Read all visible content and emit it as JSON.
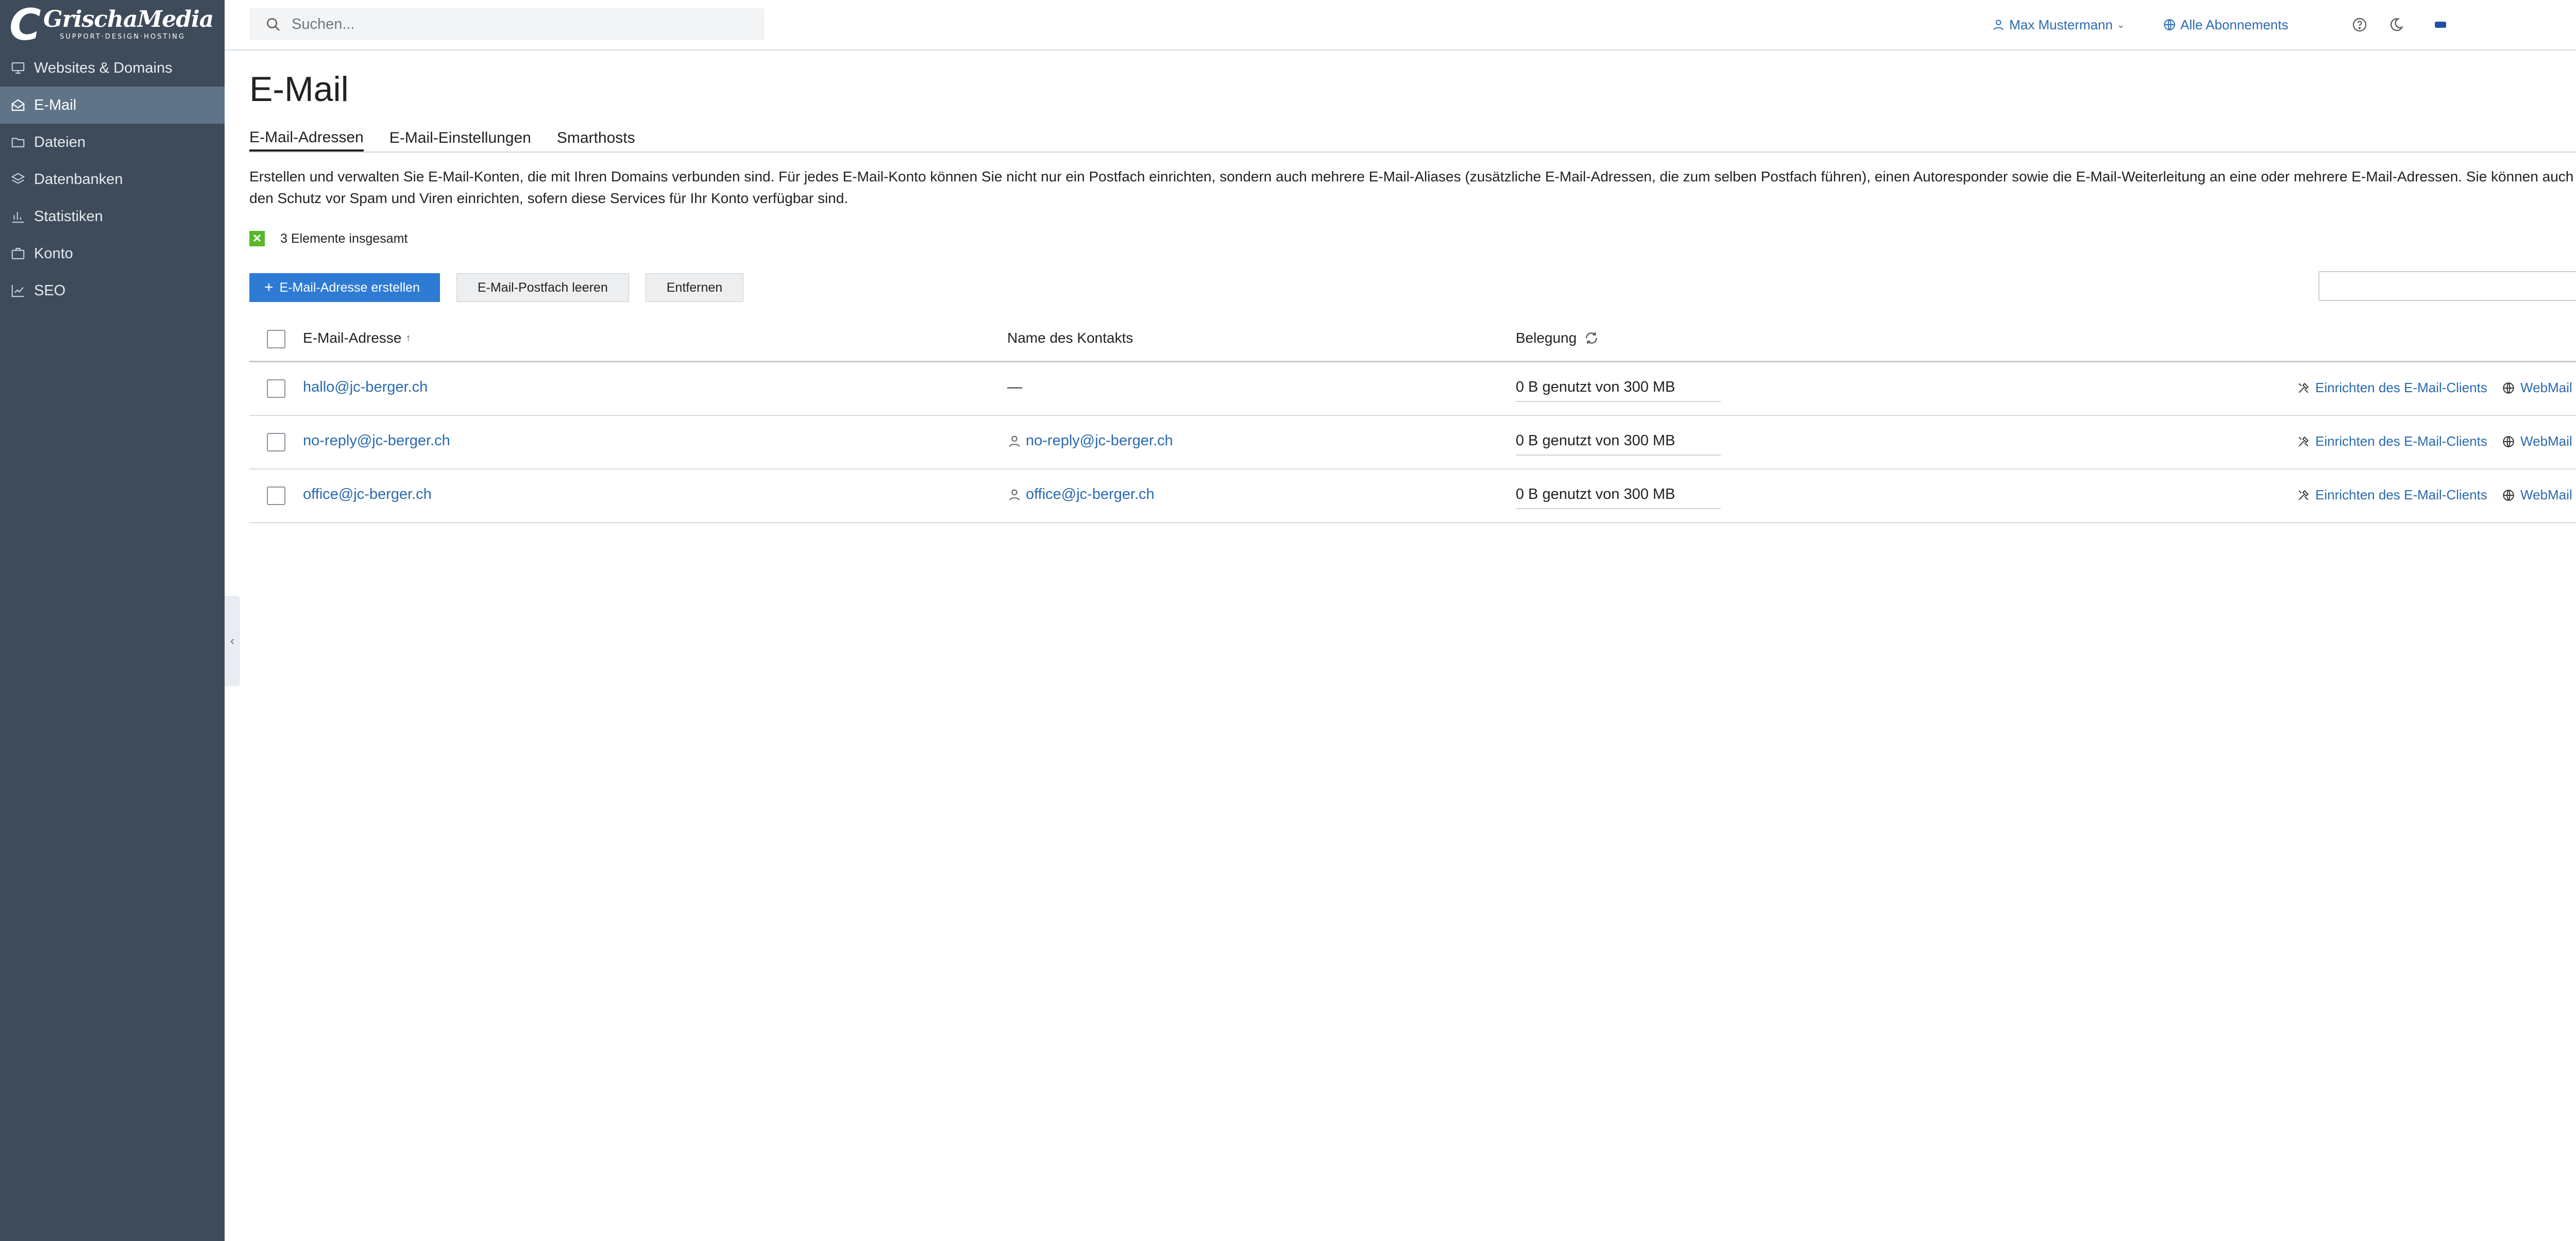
{
  "brand": {
    "name": "GrischaMedia",
    "tagline": "SUPPORT·DESIGN·HOSTING"
  },
  "sidebar": {
    "items": [
      {
        "label": "Websites & Domains",
        "icon": "monitor-icon"
      },
      {
        "label": "E-Mail",
        "icon": "envelope-icon",
        "active": true
      },
      {
        "label": "Dateien",
        "icon": "folder-icon"
      },
      {
        "label": "Datenbanken",
        "icon": "layers-icon"
      },
      {
        "label": "Statistiken",
        "icon": "bar-chart-icon"
      },
      {
        "label": "Konto",
        "icon": "briefcase-icon"
      },
      {
        "label": "SEO",
        "icon": "trend-icon"
      }
    ],
    "collapse_glyph": "‹"
  },
  "header": {
    "search_placeholder": "Suchen...",
    "user_name": "Max Mustermann",
    "subscriptions": "Alle Abonnements"
  },
  "main": {
    "title": "E-Mail",
    "tabs": [
      {
        "label": "E-Mail-Adressen",
        "active": true
      },
      {
        "label": "E-Mail-Einstellungen"
      },
      {
        "label": "Smarthosts"
      }
    ],
    "description": "Erstellen und verwalten Sie E-Mail-Konten, die mit Ihren Domains verbunden sind. Für jedes E-Mail-Konto können Sie nicht nur ein Postfach einrichten, sondern auch mehrere E-Mail-Aliases (zusätzliche E-Mail-Adressen, die zum selben Postfach führen), einen Autoresponder sowie die E-Mail-Weiterleitung an eine oder mehrere E-Mail-Adressen. Sie können auch den Schutz vor Spam und Viren einrichten, sofern diese Services für Ihr Konto verfügbar sind.",
    "count_text": "3 Elemente insgesamt",
    "buttons": {
      "create": "E-Mail-Adresse erstellen",
      "empty": "E-Mail-Postfach leeren",
      "remove": "Entfernen"
    },
    "table": {
      "columns": {
        "address": "E-Mail-Adresse",
        "sort_indicator": "↑",
        "contact": "Name des Kontakts",
        "usage": "Belegung"
      },
      "rows": [
        {
          "address": "hallo@jc-berger.ch",
          "contact": "—",
          "usage": "0 B genutzt von 300 MB",
          "setup": "Einrichten des E-Mail-Clients",
          "webmail": "WebMail"
        },
        {
          "address": "no-reply@jc-berger.ch",
          "contact": "no-reply@jc-berger.ch",
          "usage": "0 B genutzt von 300 MB",
          "setup": "Einrichten des E-Mail-Clients",
          "webmail": "WebMail"
        },
        {
          "address": "office@jc-berger.ch",
          "contact": "office@jc-berger.ch",
          "usage": "0 B genutzt von 300 MB",
          "setup": "Einrichten des E-Mail-Clients",
          "webmail": "WebMail"
        }
      ]
    }
  },
  "colors": {
    "sidebar_bg": "#3e4b5a",
    "sidebar_active": "#5f7487",
    "link": "#2a6ab0",
    "primary_button": "#2e7bd4",
    "success_badge": "#58b82a"
  }
}
